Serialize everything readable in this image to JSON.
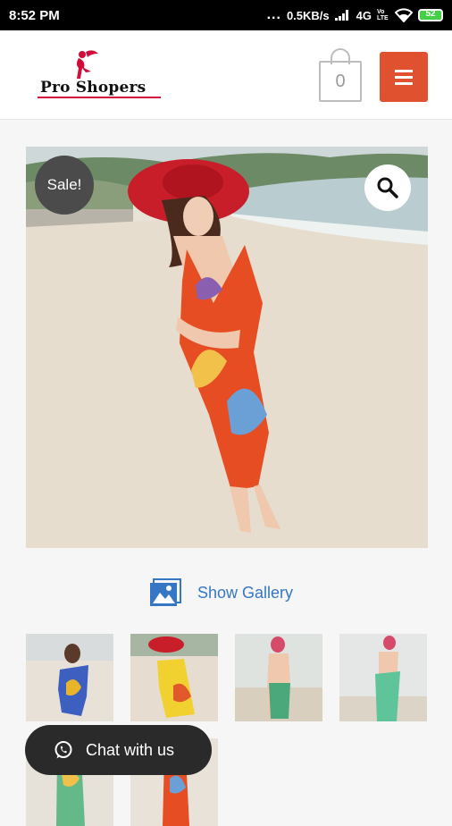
{
  "status_bar": {
    "time": "8:52 PM",
    "dots": "...",
    "network_speed": "0.5KB/s",
    "network_type": "4G",
    "volte": "Vo LTE",
    "battery": "52"
  },
  "header": {
    "logo_text": "Pro Shopers",
    "cart_count": "0",
    "menu_icon": "hamburger-icon",
    "accent_color": "#e0512f"
  },
  "product": {
    "sale_badge": "Sale!",
    "zoom_icon": "search-icon"
  },
  "gallery": {
    "show_gallery_label": "Show Gallery",
    "gallery_icon": "image-gallery-icon",
    "thumbnails": [
      {
        "name": "thumb-1"
      },
      {
        "name": "thumb-2"
      },
      {
        "name": "thumb-3"
      },
      {
        "name": "thumb-4"
      },
      {
        "name": "thumb-5"
      },
      {
        "name": "thumb-6"
      }
    ]
  },
  "chat": {
    "label": "Chat with us",
    "icon": "whatsapp-icon"
  }
}
